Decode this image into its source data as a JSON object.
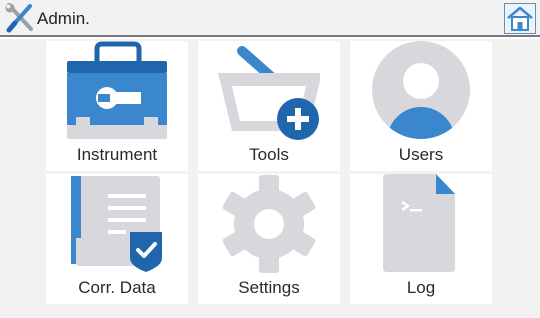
{
  "header": {
    "title": "Admin.",
    "logo_icon": "wrench-screwdriver-icon",
    "home_icon": "home-icon"
  },
  "tiles": [
    {
      "label": "Instrument",
      "icon": "toolbox-icon"
    },
    {
      "label": "Tools",
      "icon": "basket-add-icon"
    },
    {
      "label": "Users",
      "icon": "user-avatar-icon"
    },
    {
      "label": "Corr. Data",
      "icon": "document-shield-check-icon"
    },
    {
      "label": "Settings",
      "icon": "gear-icon"
    },
    {
      "label": "Log",
      "icon": "terminal-file-icon"
    }
  ],
  "colors": {
    "accent_blue": "#3a87cd",
    "dark_blue": "#1f66ad",
    "icon_gray": "#d8d8dc",
    "background": "#f2f2f2"
  }
}
